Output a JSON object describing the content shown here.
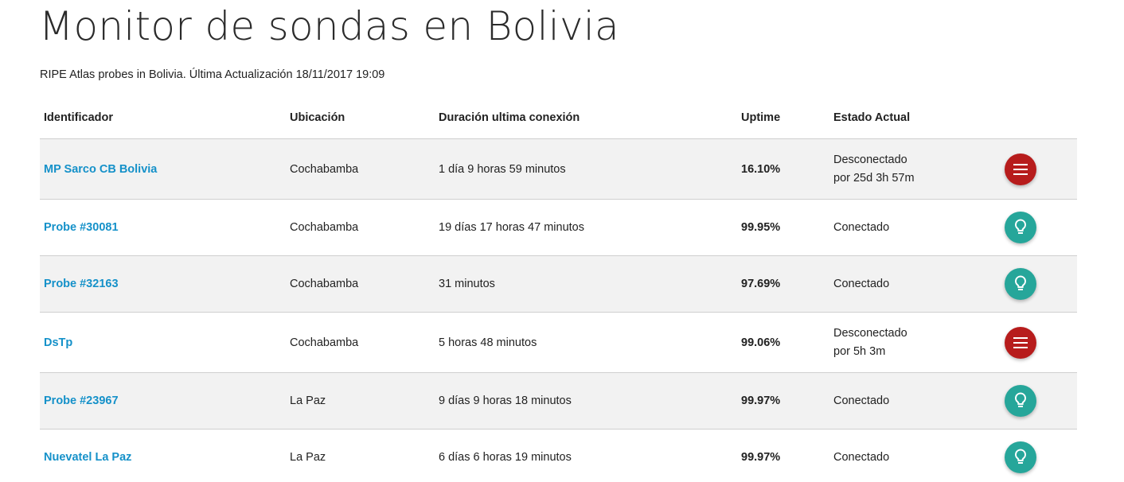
{
  "header": {
    "title": "Monitor de sondas en Bolivia",
    "subtitle": "RIPE Atlas probes in Bolivia. Última Actualización 18/11/2017 19:09"
  },
  "table": {
    "columns": {
      "id": "Identificador",
      "location": "Ubicación",
      "duration": "Duración ultima conexión",
      "uptime": "Uptime",
      "status": "Estado Actual"
    },
    "rows": [
      {
        "name": "MP Sarco CB Bolivia",
        "location": "Cochabamba",
        "duration": "1 día 9 horas 59 minutos",
        "uptime": "16.10%",
        "status_line1": "Desconectado",
        "status_line2": "por 25d 3h 57m",
        "icon": "menu-icon"
      },
      {
        "name": "Probe #30081",
        "location": "Cochabamba",
        "duration": "19 días 17 horas 47 minutos",
        "uptime": "99.95%",
        "status_line1": "Conectado",
        "icon": "lightbulb-icon"
      },
      {
        "name": "Probe #32163",
        "location": "Cochabamba",
        "duration": "31 minutos",
        "uptime": "97.69%",
        "status_line1": "Conectado",
        "icon": "lightbulb-icon"
      },
      {
        "name": "DsTp",
        "location": "Cochabamba",
        "duration": "5 horas 48 minutos",
        "uptime": "99.06%",
        "status_line1": "Desconectado",
        "status_line2": "por 5h 3m",
        "icon": "menu-icon"
      },
      {
        "name": "Probe #23967",
        "location": "La Paz",
        "duration": "9 días 9 horas 18 minutos",
        "uptime": "99.97%",
        "status_line1": "Conectado",
        "icon": "lightbulb-icon"
      },
      {
        "name": "Nuevatel La Paz",
        "location": "La Paz",
        "duration": "6 días 6 horas 19 minutos",
        "uptime": "99.97%",
        "status_line1": "Conectado",
        "icon": "lightbulb-icon"
      }
    ]
  },
  "colors": {
    "link": "#1591c9",
    "disconnected_text": "#e5473b",
    "disconnected_button": "#b71c1c",
    "connected_button": "#26a69a",
    "row_shade": "#f2f2f2"
  }
}
